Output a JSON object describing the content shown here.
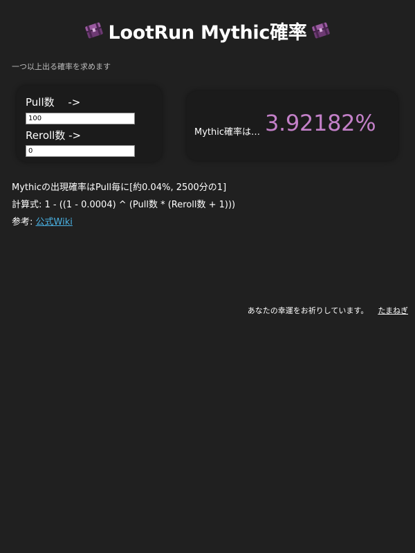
{
  "header": {
    "title": "LootRun Mythic確率",
    "left_icon": "chest-icon",
    "right_icon": "chest-icon"
  },
  "subtitle": "一つ以上出る確率を求めます",
  "inputs": {
    "pull_label": "Pull数　 ->",
    "pull_value": "100",
    "reroll_label": "Reroll数 ->",
    "reroll_value": "0"
  },
  "result": {
    "label": "Mythic確率は…",
    "value": "3.92182%"
  },
  "info": {
    "rate_text": "Mythicの出現確率はPull毎に[約0.04%, 2500分の1]",
    "formula_text": "計算式: 1 - ((1 - 0.0004) ^ (Pull数 * (Reroll数 + 1)))",
    "reference_prefix": "参考: ",
    "reference_link": "公式Wiki"
  },
  "footer": {
    "message": "あなたの幸運をお祈りしています。",
    "author": "たまねぎ"
  },
  "colors": {
    "background": "#202020",
    "panel": "#1b1b1b",
    "result_accent": "#c380c8",
    "link": "#4ab3e6"
  }
}
